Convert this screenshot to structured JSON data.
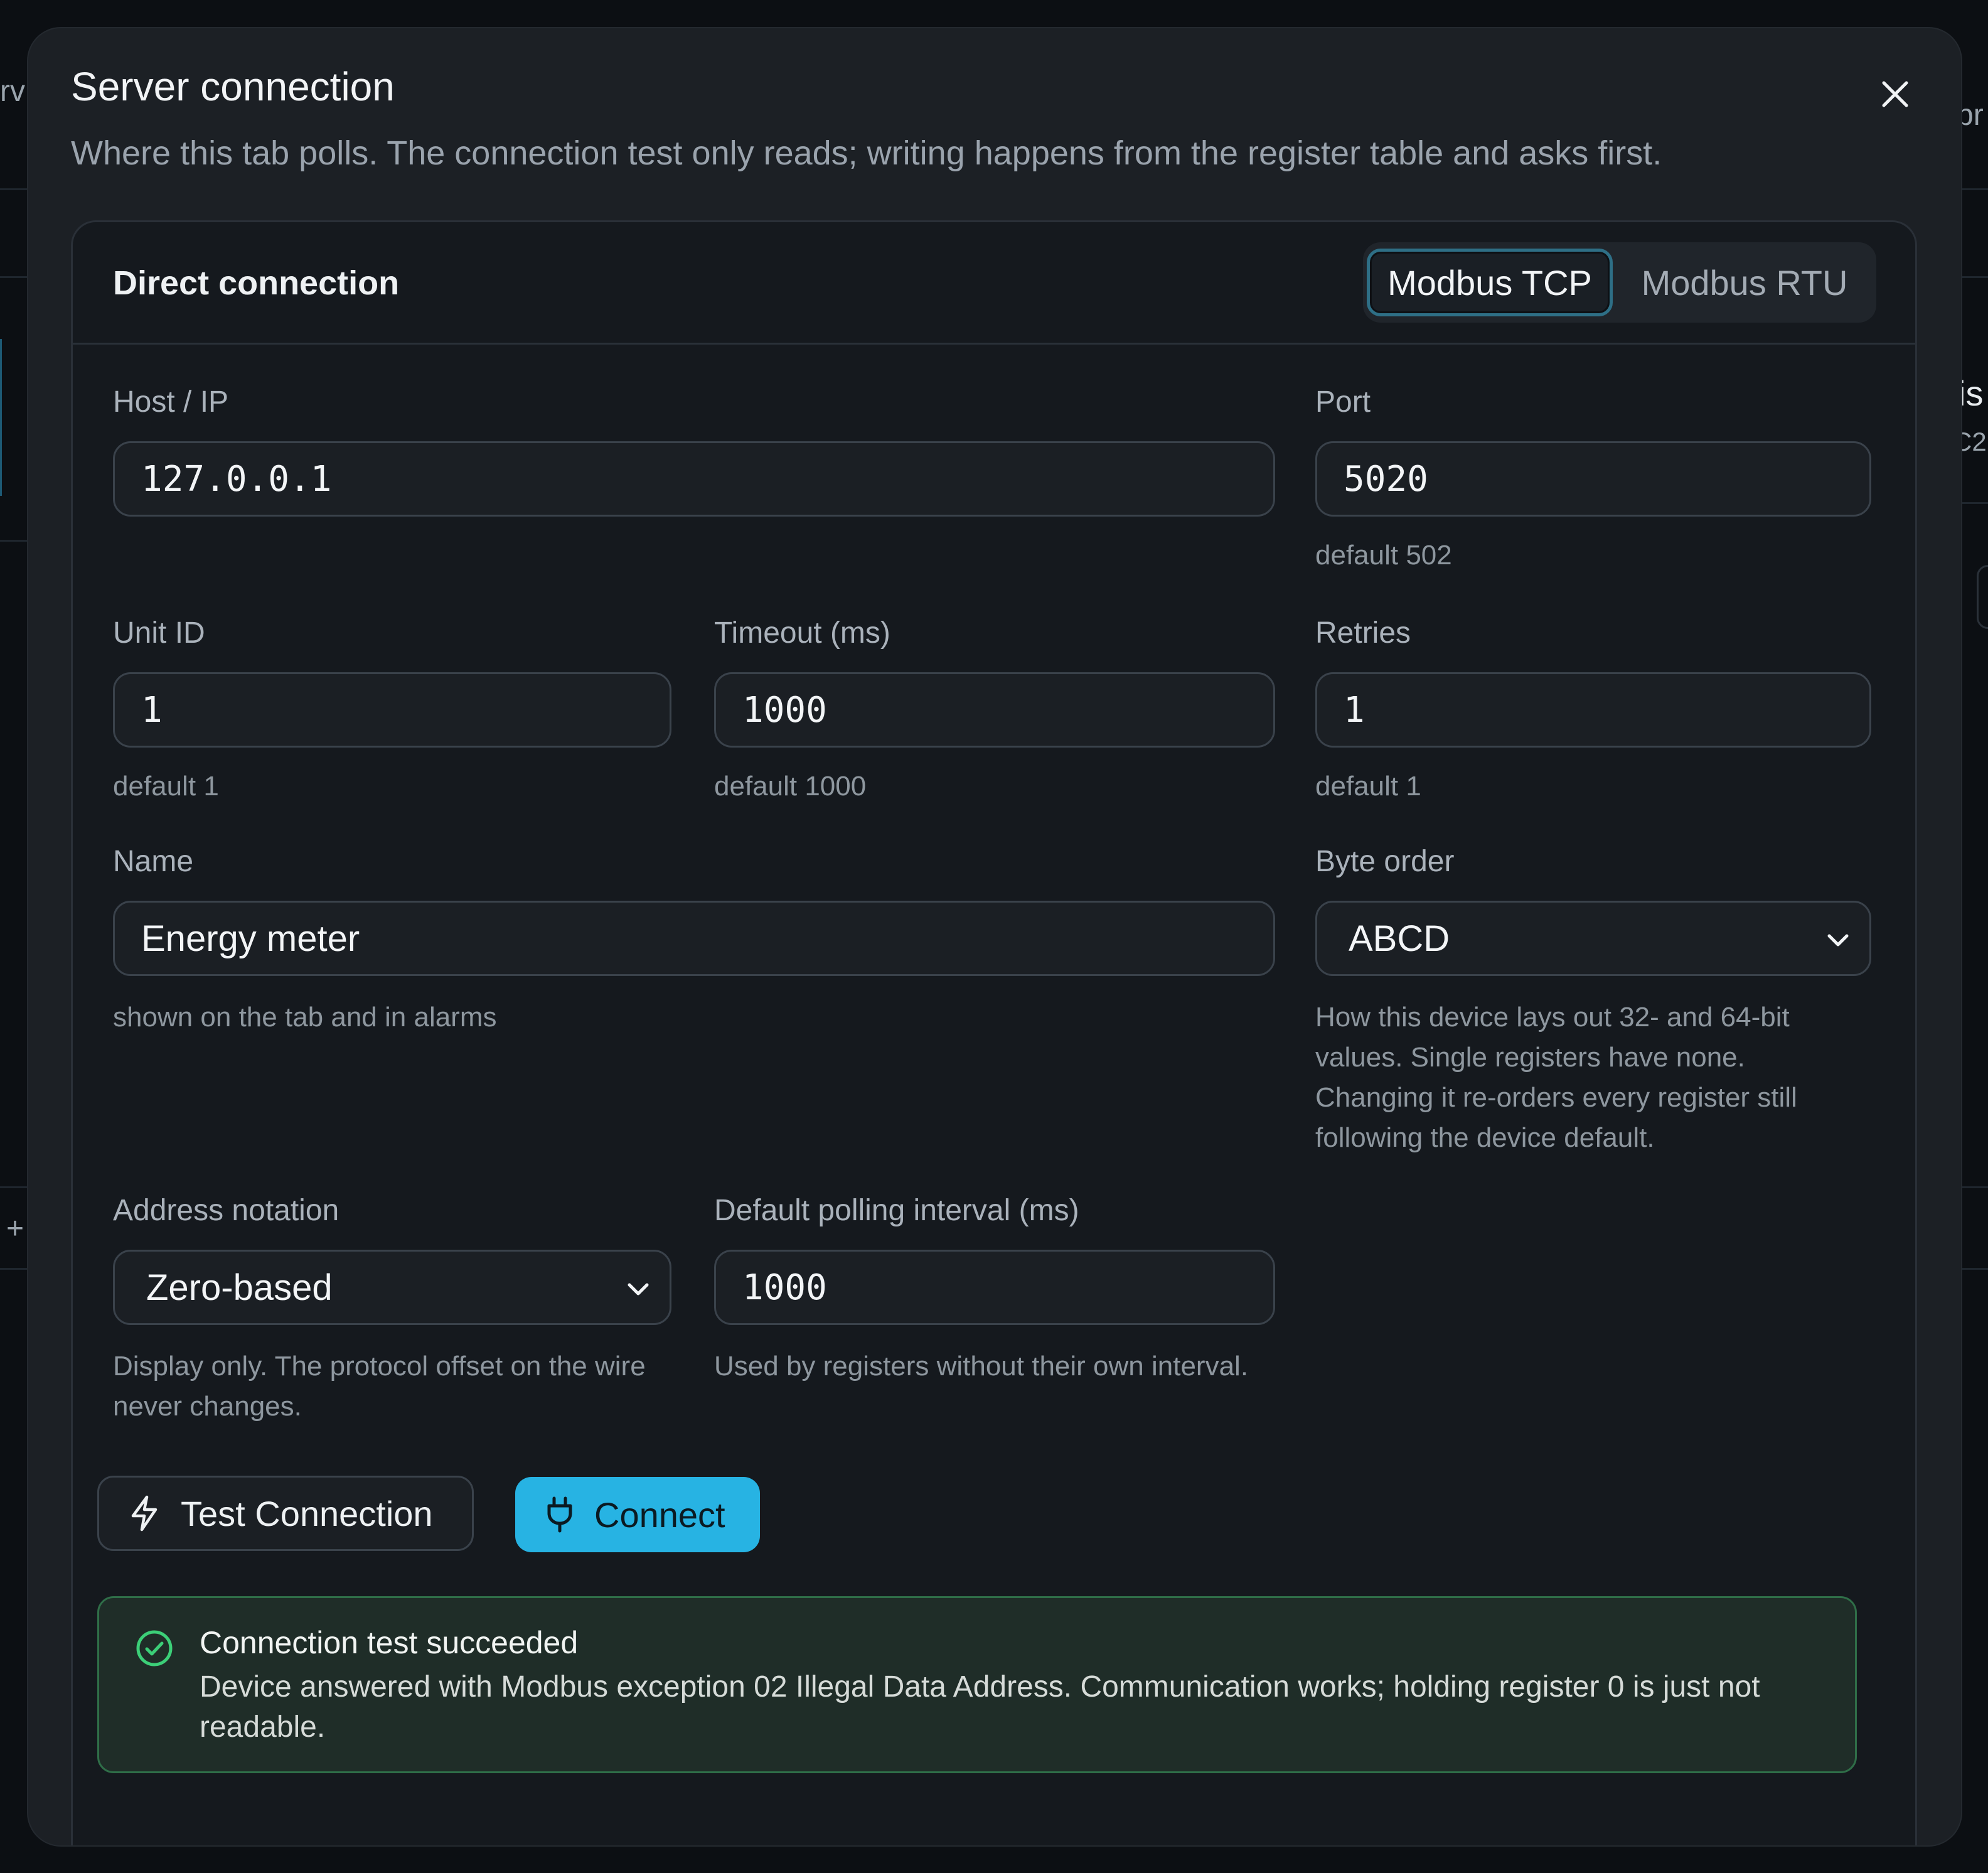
{
  "dialog": {
    "title": "Server connection",
    "subtitle": "Where this tab polls. The connection test only reads; writing happens from the register table and asks first."
  },
  "panel": {
    "title": "Direct connection",
    "protocol_options": [
      "Modbus TCP",
      "Modbus RTU"
    ],
    "protocol_selected": "Modbus TCP"
  },
  "fields": {
    "host": {
      "label": "Host / IP",
      "value": "127.0.0.1"
    },
    "port": {
      "label": "Port",
      "value": "5020",
      "hint": "default 502"
    },
    "unit_id": {
      "label": "Unit ID",
      "value": "1",
      "hint": "default 1"
    },
    "timeout": {
      "label": "Timeout (ms)",
      "value": "1000",
      "hint": "default 1000"
    },
    "retries": {
      "label": "Retries",
      "value": "1",
      "hint": "default 1"
    },
    "name": {
      "label": "Name",
      "value": "Energy meter",
      "hint": "shown on the tab and in alarms"
    },
    "byte_order": {
      "label": "Byte order",
      "value": "ABCD",
      "hint": "How this device lays out 32- and 64-bit values. Single registers have none. Changing it re-orders every register still following the device default."
    },
    "address_notation": {
      "label": "Address notation",
      "value": "Zero-based",
      "hint": "Display only. The protocol offset on the wire never changes."
    },
    "polling": {
      "label": "Default polling interval (ms)",
      "value": "1000",
      "hint": "Used by registers without their own interval."
    }
  },
  "actions": {
    "test_label": "Test Connection",
    "connect_label": "Connect"
  },
  "result": {
    "title": "Connection test succeeded",
    "message": "Device answered with Modbus exception 02 Illegal Data Address. Communication works; holding register 0 is just not readable."
  },
  "background": {
    "fragments": [
      "rv",
      "pr",
      "is",
      "C2",
      "+"
    ]
  },
  "colors": {
    "accent": "#27b3e3",
    "success": "#2f6e48",
    "success_icon": "#3ccf78"
  }
}
